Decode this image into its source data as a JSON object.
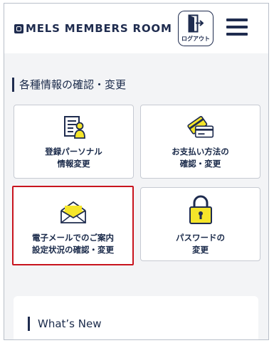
{
  "header": {
    "logo_text": "MELS MEMBERS ROOM",
    "logout_label": "ログアウト",
    "icons": {
      "logo": "logo-mark",
      "logout": "logout-door-icon",
      "menu": "hamburger-menu-icon"
    }
  },
  "section": {
    "title": "各種情報の確認・変更"
  },
  "tiles": [
    {
      "label": "登録パーソナル\n情報変更",
      "icon": "personal-info-icon"
    },
    {
      "label": "お支払い方法の\n確認・変更",
      "icon": "payment-card-icon"
    },
    {
      "label": "電子メールでのご案内\n設定状況の確認・変更",
      "icon": "envelope-icon",
      "highlighted": true
    },
    {
      "label": "パスワードの\n変更",
      "icon": "padlock-icon"
    }
  ],
  "news": {
    "title": "What’s New"
  },
  "colors": {
    "navy": "#1f2c4f",
    "accent_yellow": "#f5e52a",
    "highlight_red": "#c8141e",
    "background": "#f3f4f6"
  }
}
